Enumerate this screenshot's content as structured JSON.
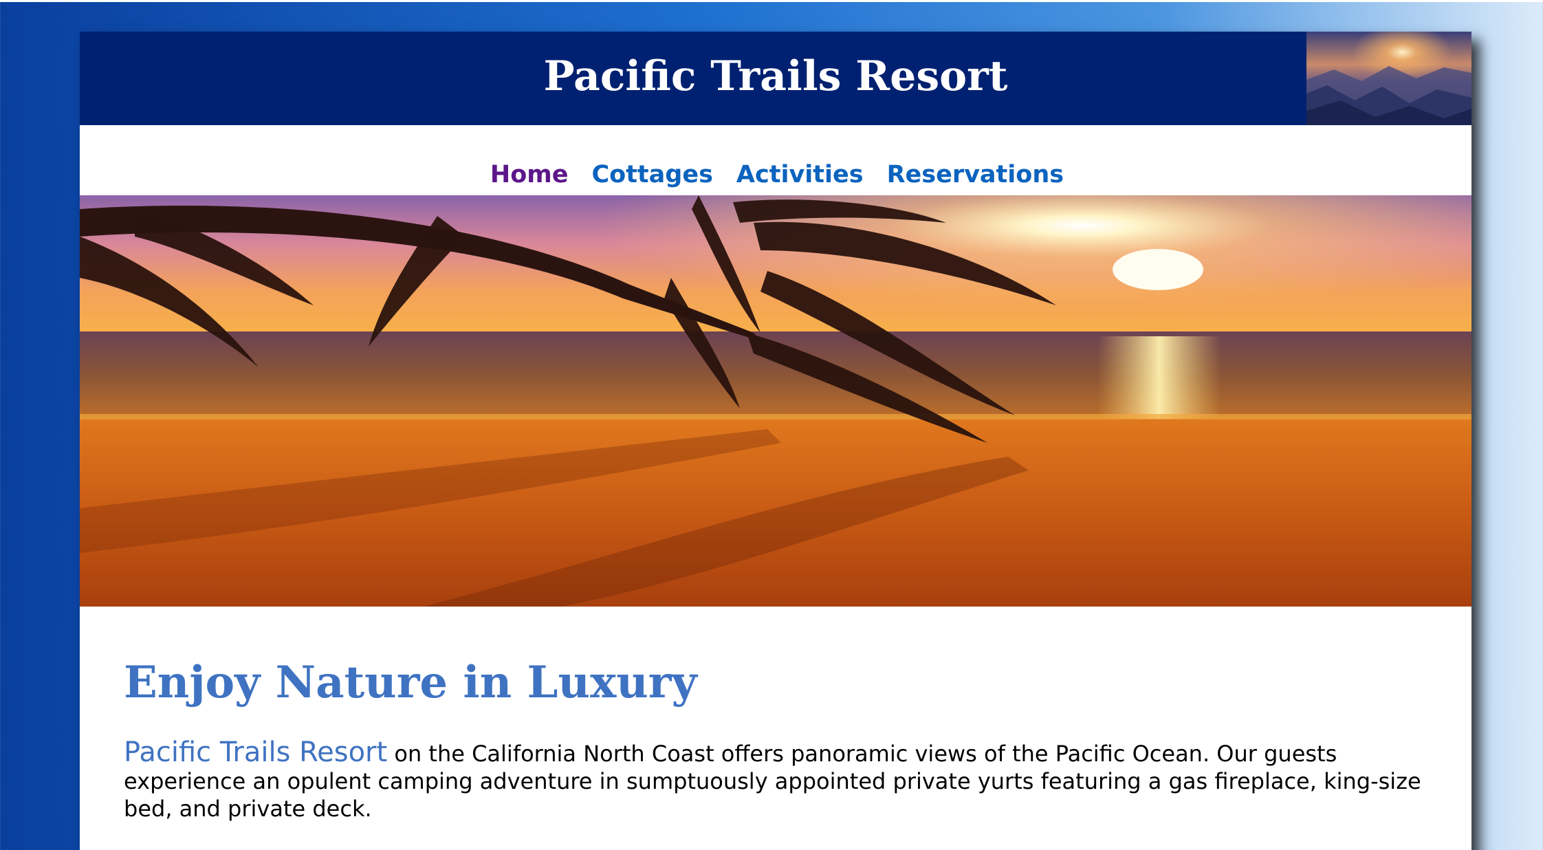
{
  "header": {
    "title": "Pacific Trails Resort"
  },
  "nav": {
    "items": [
      {
        "label": "Home",
        "visited": true
      },
      {
        "label": "Cottages",
        "visited": false
      },
      {
        "label": "Activities",
        "visited": false
      },
      {
        "label": "Reservations",
        "visited": false
      }
    ]
  },
  "main": {
    "heading": "Enjoy Nature in Luxury",
    "resort_name": "Pacific Trails Resort",
    "intro_rest": " on the California North Coast offers panoramic views of the Pacific Ocean. Our guests experience an opulent camping adventure in sumptuously appointed private yurts featuring a gas fireplace, king-size bed, and private deck."
  },
  "colors": {
    "header_bg": "#002171",
    "nav_link": "#0b63be",
    "nav_visited": "#5c168a",
    "heading": "#3f73c2"
  }
}
